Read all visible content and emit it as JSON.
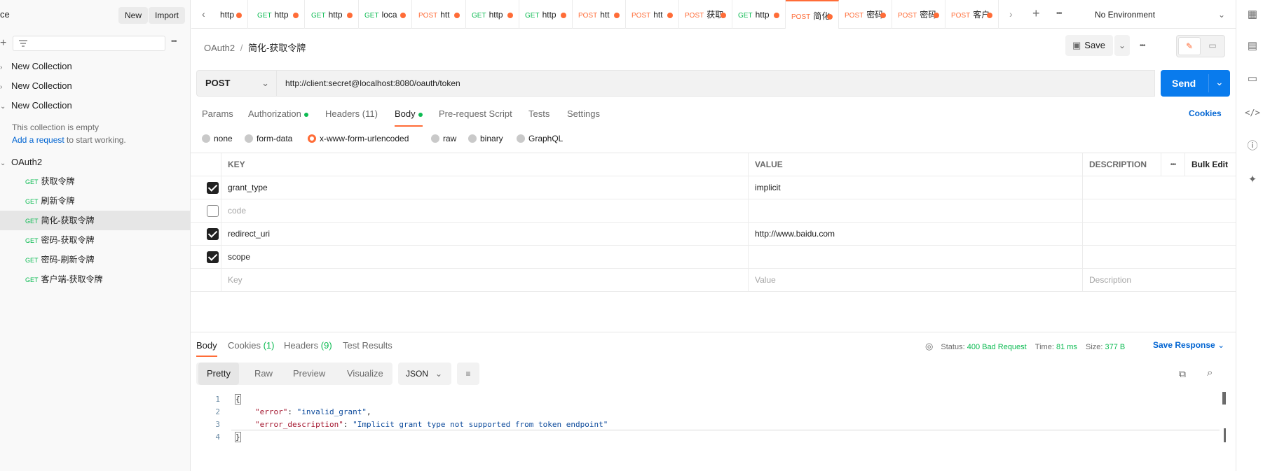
{
  "sidebar": {
    "title_partial": "ce",
    "new_label": "New",
    "import_label": "Import",
    "more": "•••",
    "collections": [
      {
        "name": "New Collection",
        "expanded": false
      },
      {
        "name": "New Collection",
        "expanded": false
      },
      {
        "name": "New Collection",
        "expanded": true
      }
    ],
    "empty_text": "This collection is empty",
    "add_request_link": "Add a request",
    "add_request_suffix": " to start working.",
    "oauth_collection": "OAuth2",
    "requests": [
      {
        "method": "GET",
        "name": "获取令牌"
      },
      {
        "method": "GET",
        "name": "刷新令牌"
      },
      {
        "method": "GET",
        "name": "简化-获取令牌",
        "active": true
      },
      {
        "method": "GET",
        "name": "密码-获取令牌"
      },
      {
        "method": "GET",
        "name": "密码-刷新令牌"
      },
      {
        "method": "GET",
        "name": "客户端-获取令牌"
      }
    ]
  },
  "tabs": [
    {
      "method": "",
      "label": "http"
    },
    {
      "method": "GET",
      "label": "http"
    },
    {
      "method": "GET",
      "label": "http"
    },
    {
      "method": "GET",
      "label": "loca"
    },
    {
      "method": "POST",
      "label": "htt"
    },
    {
      "method": "GET",
      "label": "http"
    },
    {
      "method": "GET",
      "label": "http"
    },
    {
      "method": "POST",
      "label": "htt"
    },
    {
      "method": "POST",
      "label": "htt"
    },
    {
      "method": "POST",
      "label": "获取"
    },
    {
      "method": "GET",
      "label": "http"
    },
    {
      "method": "POST",
      "label": "简化",
      "active": true
    },
    {
      "method": "POST",
      "label": "密码"
    },
    {
      "method": "POST",
      "label": "密码"
    },
    {
      "method": "POST",
      "label": "客户"
    }
  ],
  "environment": "No Environment",
  "breadcrumb": {
    "parent": "OAuth2",
    "separator": "/",
    "current": "简化-获取令牌"
  },
  "save_label": "Save",
  "request": {
    "method": "POST",
    "url": "http://client:secret@localhost:8080/oauth/token",
    "send_label": "Send"
  },
  "request_tabs": [
    "Params",
    "Authorization",
    "Headers (11)",
    "Body",
    "Pre-request Script",
    "Tests",
    "Settings"
  ],
  "cookies_label": "Cookies",
  "body_modes": [
    "none",
    "form-data",
    "x-www-form-urlencoded",
    "raw",
    "binary",
    "GraphQL"
  ],
  "selected_body_mode": "x-www-form-urlencoded",
  "params_table": {
    "headers": [
      "KEY",
      "VALUE",
      "DESCRIPTION"
    ],
    "bulk_edit": "Bulk Edit",
    "rows": [
      {
        "checked": true,
        "key": "grant_type",
        "value": "implicit",
        "description": ""
      },
      {
        "checked": false,
        "key": "code",
        "value": "",
        "description": ""
      },
      {
        "checked": true,
        "key": "redirect_uri",
        "value": "http://www.baidu.com",
        "description": ""
      },
      {
        "checked": true,
        "key": "scope",
        "value": "",
        "description": ""
      }
    ],
    "placeholders": {
      "key": "Key",
      "value": "Value",
      "description": "Description"
    }
  },
  "response": {
    "tabs": [
      "Body",
      "Cookies",
      "Headers",
      "Test Results"
    ],
    "cookies_count": "(1)",
    "headers_count": "(9)",
    "status_label": "Status:",
    "status_value": "400 Bad Request",
    "time_label": "Time:",
    "time_value": "81 ms",
    "size_label": "Size:",
    "size_value": "377 B",
    "save_response": "Save Response",
    "view_modes": [
      "Pretty",
      "Raw",
      "Preview",
      "Visualize"
    ],
    "format": "JSON",
    "code_lines": [
      {
        "num": "1",
        "text": "{"
      },
      {
        "num": "2",
        "key": "\"error\"",
        "val": "\"invalid_grant\"",
        "trail": ","
      },
      {
        "num": "3",
        "key": "\"error_description\"",
        "val": "\"Implicit grant type not supported from token endpoint\"",
        "trail": ""
      },
      {
        "num": "4",
        "text": "}"
      }
    ]
  }
}
